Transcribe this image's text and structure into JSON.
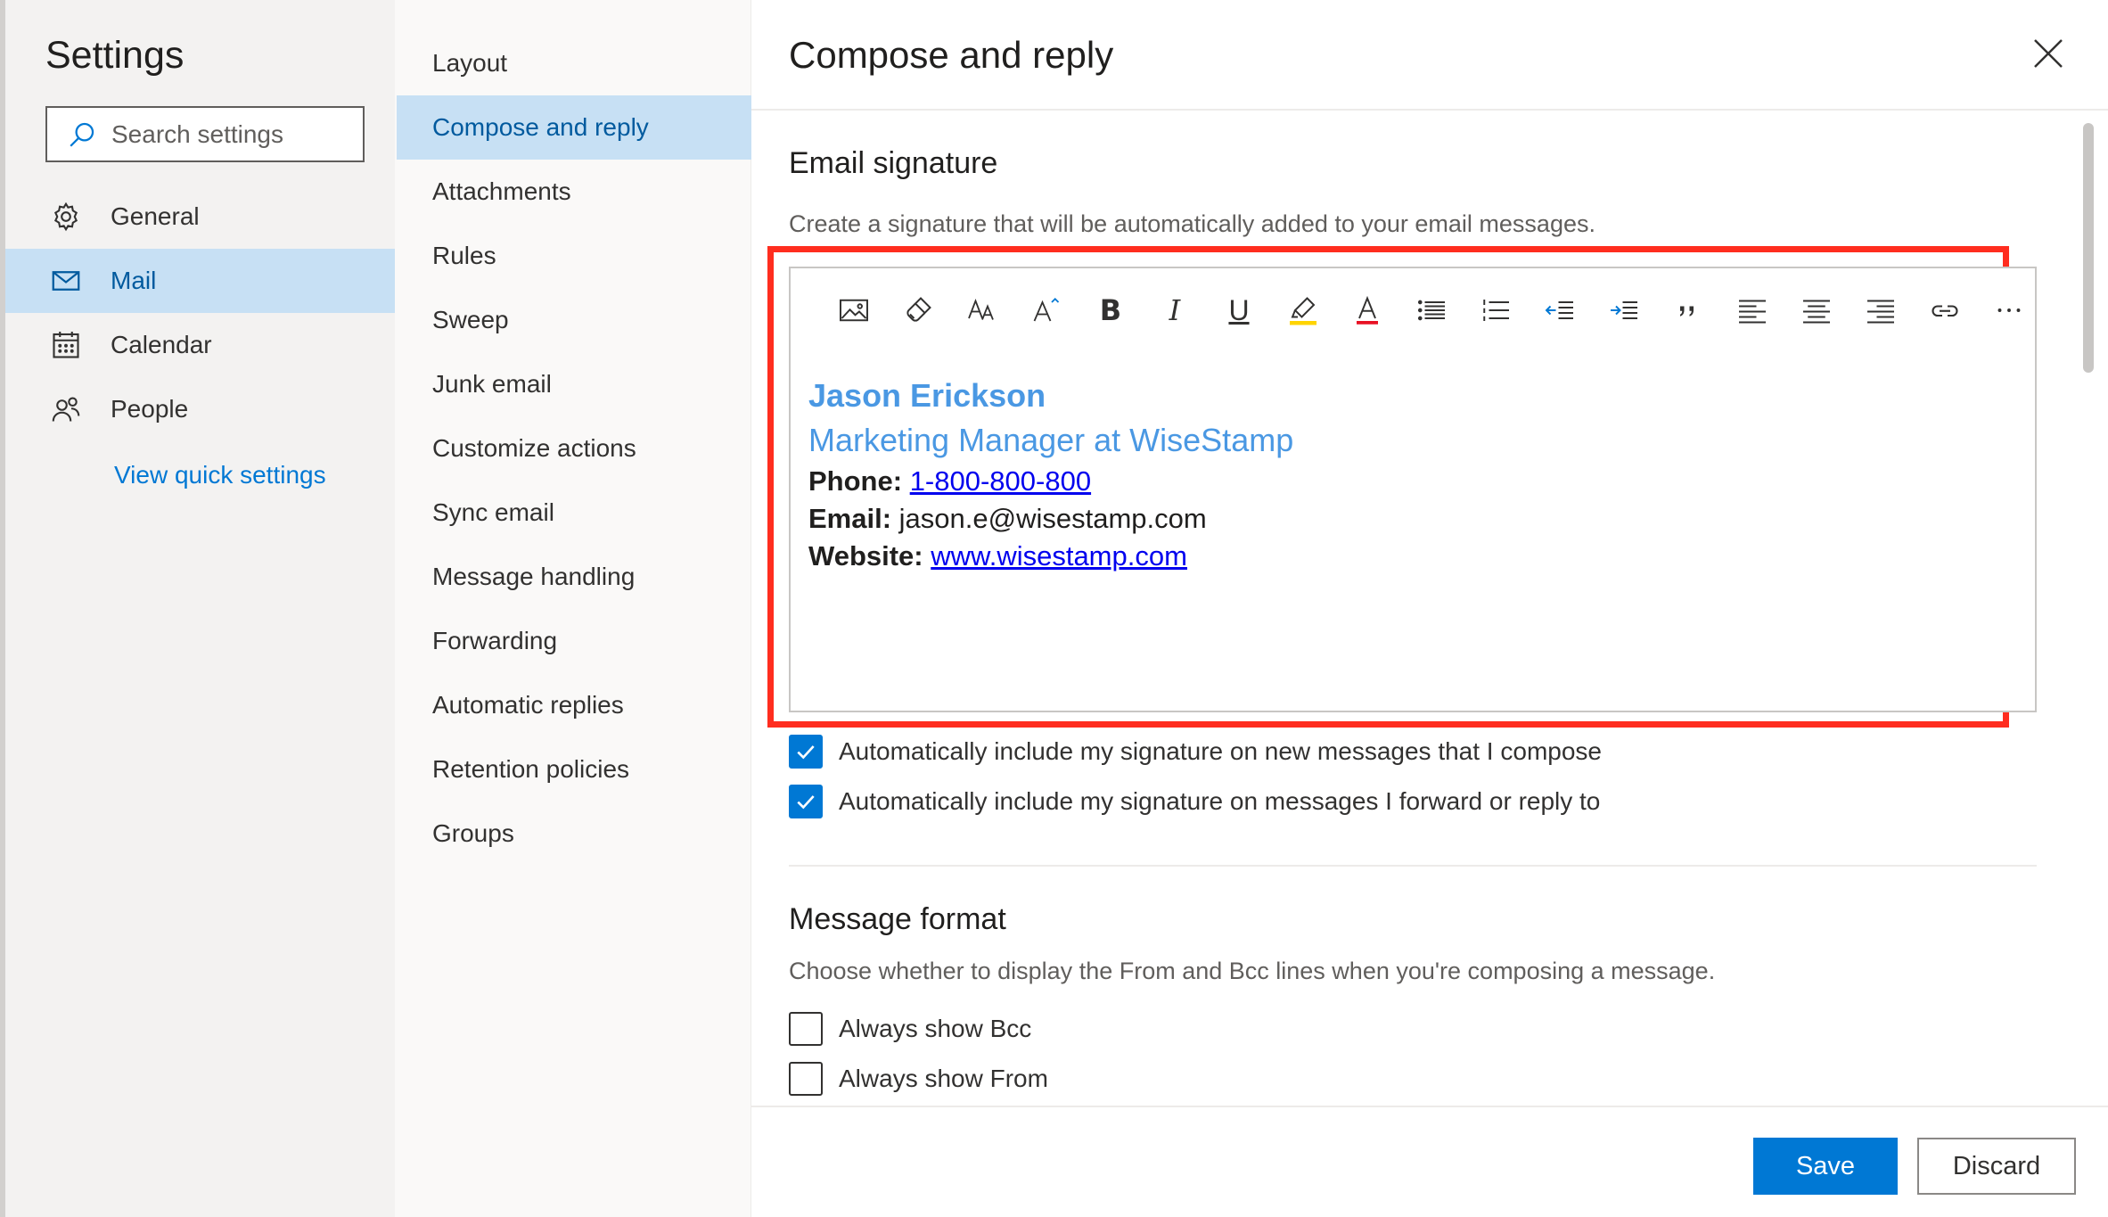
{
  "settings": {
    "title": "Settings",
    "search_placeholder": "Search settings",
    "categories": [
      {
        "label": "General",
        "icon": "gear-icon"
      },
      {
        "label": "Mail",
        "icon": "mail-icon",
        "active": true
      },
      {
        "label": "Calendar",
        "icon": "calendar-icon"
      },
      {
        "label": "People",
        "icon": "people-icon"
      }
    ],
    "quick_settings_link": "View quick settings"
  },
  "nav": {
    "items": [
      "Layout",
      "Compose and reply",
      "Attachments",
      "Rules",
      "Sweep",
      "Junk email",
      "Customize actions",
      "Sync email",
      "Message handling",
      "Forwarding",
      "Automatic replies",
      "Retention policies",
      "Groups"
    ],
    "active_item": "Compose and reply"
  },
  "content": {
    "title": "Compose and reply",
    "signature": {
      "heading": "Email signature",
      "description": "Create a signature that will be automatically added to your email messages.",
      "toolbar": [
        "image-icon",
        "format-painter-icon",
        "font-size-icon",
        "increase-font-icon",
        "bold-icon",
        "italic-icon",
        "underline-icon",
        "highlight-icon",
        "font-color-icon",
        "bullet-list-icon",
        "numbered-list-icon",
        "decrease-indent-icon",
        "increase-indent-icon",
        "quote-icon",
        "align-left-icon",
        "align-center-icon",
        "align-right-icon",
        "link-icon",
        "more-icon"
      ],
      "name": "Jason Erickson",
      "role": "Marketing Manager at WiseStamp",
      "phone_label": "Phone:",
      "phone": "1-800-800-800",
      "email_label": "Email:",
      "email": "jason.e@wisestamp.com",
      "website_label": "Website:",
      "website": "www.wisestamp.com"
    },
    "options": {
      "auto_new": {
        "label": "Automatically include my signature on new messages that I compose",
        "checked": true
      },
      "auto_reply": {
        "label": "Automatically include my signature on messages I forward or reply to",
        "checked": true
      }
    },
    "message_format": {
      "heading": "Message format",
      "description": "Choose whether to display the From and Bcc lines when you're composing a message.",
      "show_bcc": {
        "label": "Always show Bcc",
        "checked": false
      },
      "show_from": {
        "label": "Always show From",
        "checked": false
      }
    },
    "footer": {
      "save_label": "Save",
      "discard_label": "Discard"
    }
  },
  "colors": {
    "accent": "#0078d4",
    "selected_bg": "#c7e0f4",
    "signature_blue": "#4a98e3",
    "highlight_box": "#ff2d1f"
  }
}
